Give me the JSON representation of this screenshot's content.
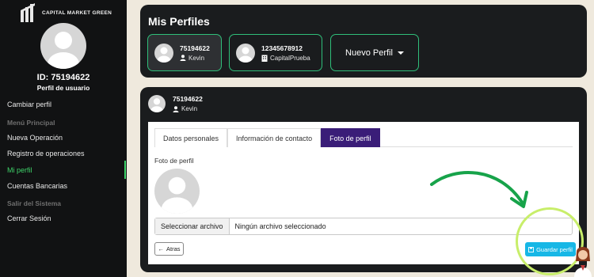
{
  "brand": {
    "name": "CAPITAL MARKET GREEN"
  },
  "sidebar": {
    "user_id": "ID: 75194622",
    "user_role": "Perfil de usuario",
    "items": [
      {
        "label": "Cambiar perfil"
      },
      {
        "label": "Menú Principal"
      },
      {
        "label": "Nueva Operación"
      },
      {
        "label": "Registro de operaciones"
      },
      {
        "label": "Mi perfil"
      },
      {
        "label": "Cuentas Bancarias"
      },
      {
        "label": "Salir del Sistema"
      },
      {
        "label": "Cerrar Sesión"
      }
    ]
  },
  "profiles": {
    "title": "Mis Perfiles",
    "list": [
      {
        "id": "75194622",
        "name": "Kevin",
        "type_icon": "user-icon"
      },
      {
        "id": "12345678912",
        "name": "CapitalPrueba",
        "type_icon": "building-icon"
      }
    ],
    "new_profile_label": "Nuevo Perfil"
  },
  "detail": {
    "id": "75194622",
    "name": "Kevin",
    "tabs": [
      {
        "label": "Datos personales"
      },
      {
        "label": "Información de contacto"
      },
      {
        "label": "Foto de perfil"
      }
    ],
    "photo_label": "Foto de perfil",
    "file_button": "Seleccionar archivo",
    "file_status": "Ningún archivo seleccionado",
    "back_label": "Atras",
    "save_label": "Guardar perfil"
  },
  "colors": {
    "accent_green": "#3fd46a",
    "tab_active": "#3a1d78",
    "save_button": "#17b7e6",
    "highlight": "#c8ee6a",
    "arrow": "#17a34a"
  }
}
